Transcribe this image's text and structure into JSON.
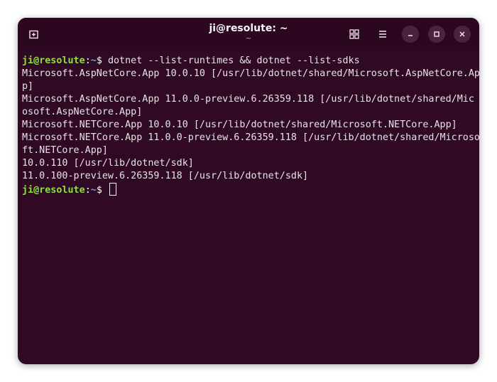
{
  "window": {
    "title": "ji@resolute: ~",
    "subtitle": "~"
  },
  "icons": {
    "new_tab": "plus-in-box-icon",
    "view": "grid-icon",
    "menu": "hamburger-menu-icon",
    "minimize": "minimize-icon",
    "maximize": "maximize-icon",
    "close": "close-icon"
  },
  "colors": {
    "background": "#300a24",
    "prompt_user": "#8ae234",
    "prompt_path": "#729fcf",
    "text": "#e8e2e5"
  },
  "terminal": {
    "prompt": {
      "user": "ji@resolute",
      "sep": ":",
      "path": "~",
      "dollar": "$ "
    },
    "command": "dotnet --list-runtimes && dotnet --list-sdks",
    "output": [
      "Microsoft.AspNetCore.App 10.0.10 [/usr/lib/dotnet/shared/Microsoft.AspNetCore.Ap",
      "p]",
      "Microsoft.AspNetCore.App 11.0.0-preview.6.26359.118 [/usr/lib/dotnet/shared/Mic",
      "osoft.AspNetCore.App]",
      "Microsoft.NETCore.App 10.0.10 [/usr/lib/dotnet/shared/Microsoft.NETCore.App]",
      "Microsoft.NETCore.App 11.0.0-preview.6.26359.118 [/usr/lib/dotnet/shared/Microso",
      "ft.NETCore.App]",
      "10.0.110 [/usr/lib/dotnet/sdk]",
      "11.0.100-preview.6.26359.118 [/usr/lib/dotnet/sdk]"
    ]
  }
}
